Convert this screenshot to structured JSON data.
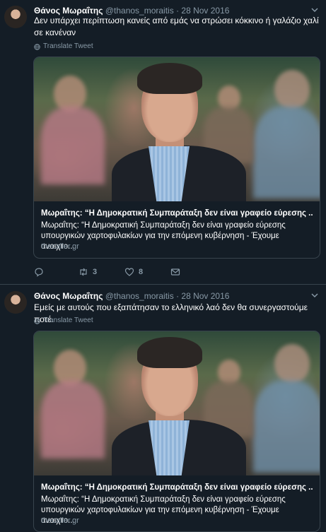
{
  "tweets": [
    {
      "author_name": "Θάνος Μωραΐτης",
      "handle": "@thanos_moraitis",
      "separator": "·",
      "date": "28 Nov 2016",
      "text": "Δεν υπάρχει περίπτωση κανείς από εμάς να στρώσει κόκκινο ή γαλάζιο χαλί σε κανέναν",
      "translate_label": "Translate Tweet",
      "card": {
        "title": "Μωραΐτης: “Η Δημοκρατική Συμπαράταξη δεν είναι γραφείο εύρεσης ...",
        "description": "Μωραΐτης: “Η Δημοκρατική Συμπαράταξη δεν είναι γραφείο εύρεσης υπουργικών χαρτοφυλακίων για την επόμενη κυβέρνηση - Έχουμε ανοιχτο...",
        "domain": "thecaller.gr"
      },
      "actions": {
        "reply_count": "",
        "retweet_count": "3",
        "like_count": "8"
      }
    },
    {
      "author_name": "Θάνος Μωραΐτης",
      "handle": "@thanos_moraitis",
      "separator": "·",
      "date": "28 Nov 2016",
      "text": "Εμείς με αυτούς που εξαπάτησαν το ελληνικό λαό δεν θα συνεργαστούμε ποτέ.",
      "translate_label": "Translate Tweet",
      "card": {
        "title": "Μωραΐτης: “Η Δημοκρατική Συμπαράταξη δεν είναι γραφείο εύρεσης ...",
        "description": "Μωραΐτης: “Η Δημοκρατική Συμπαράταξη δεν είναι γραφείο εύρεσης υπουργικών χαρτοφυλακίων για την επόμενη κυβέρνηση - Έχουμε ανοιχτο...",
        "domain": "thecaller.gr"
      }
    }
  ],
  "icons": {
    "reply": "reply-icon",
    "retweet": "retweet-icon",
    "like": "heart-icon",
    "dm": "envelope-icon",
    "more": "chevron-down-icon",
    "translate": "globe-icon"
  },
  "colors": {
    "background": "#141d26",
    "border": "#38444d",
    "secondary_text": "#8899a6",
    "primary_text": "#ffffff"
  }
}
